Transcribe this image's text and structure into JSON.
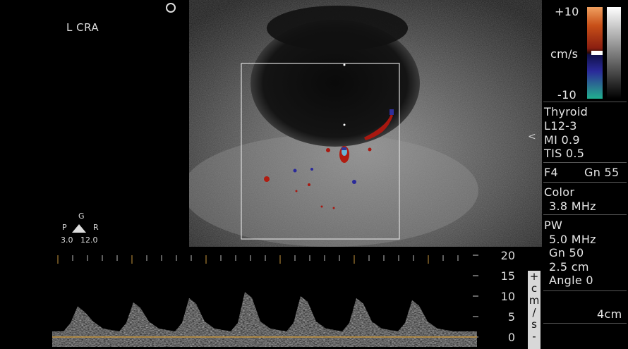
{
  "image": {
    "region_label": "L CRA",
    "probe_orientation": {
      "g": "G",
      "p": "P",
      "r": "R",
      "left_value": "3.0",
      "right_value": "12.0"
    },
    "depth_caret": "<"
  },
  "spectrum": {
    "scale_labels": [
      "20",
      "15",
      "10",
      "5",
      "0"
    ],
    "unit_letters": [
      "+",
      "c",
      "m",
      "/",
      "s",
      "-"
    ],
    "peaks_cm_s": [
      7.5,
      8.5,
      9.5,
      11,
      10,
      9.5,
      9
    ]
  },
  "panel": {
    "color_max": "+10",
    "color_min": "-10",
    "color_unit": "cm/s",
    "preset": "Thyroid",
    "probe": "L12-3",
    "mi": "MI 0.9",
    "tis": "TIS 0.5",
    "freq_setting": "F4",
    "gain": "Gn 55",
    "color_title": "Color",
    "color_freq": "3.8 MHz",
    "pw_title": "PW",
    "pw_freq": "5.0 MHz",
    "pw_gain": "Gn 50",
    "pw_depth": "2.5 cm",
    "pw_angle": "Angle 0",
    "depth": "4cm"
  },
  "colors": {
    "background": "#000000",
    "text": "#e6e6e6",
    "baseline": "#c8963c",
    "doppler_red": "#b01c10",
    "doppler_blue": "#28288c"
  }
}
